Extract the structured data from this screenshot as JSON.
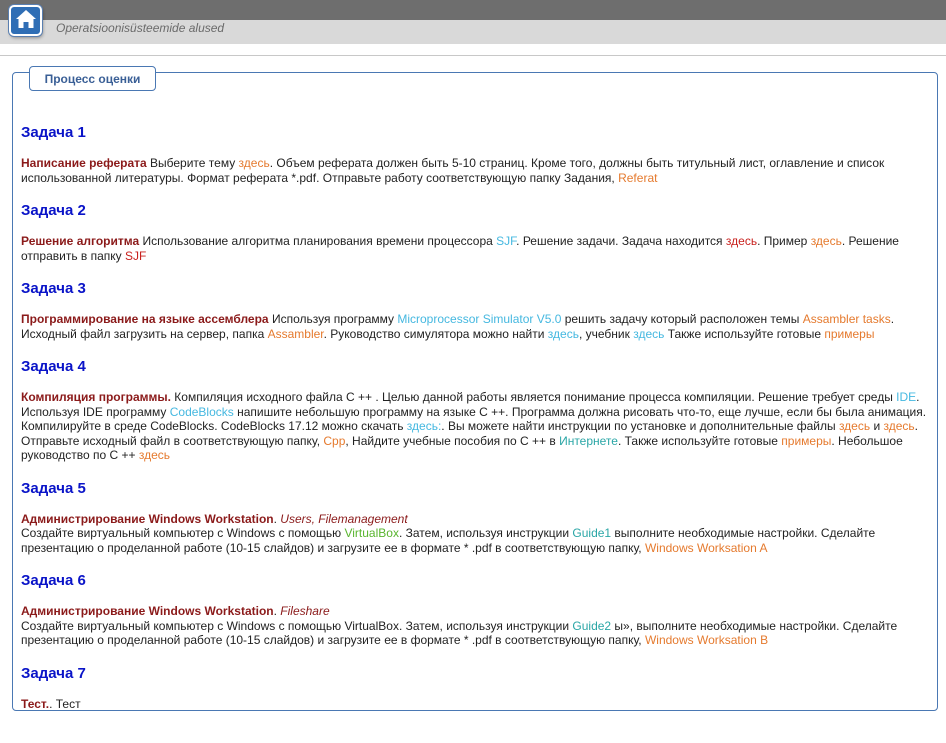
{
  "header": {
    "course_title": "Operatsioonisüsteemide alused",
    "home_icon": "home-icon"
  },
  "panel": {
    "title": "Процесс оценки"
  },
  "colors": {
    "task_heading": "#0a14c8",
    "task_title": "#8b1a1a",
    "link_orange": "#e57a2e",
    "link_blue": "#45b8e0",
    "link_red": "#c8201d",
    "link_green": "#59b52f",
    "link_teal": "#2aa6a6",
    "panel_border": "#4a78b3"
  },
  "tasks": [
    {
      "heading": "Задача 1",
      "title": "Написание реферата",
      "t1": " Выберите тему ",
      "l1": "здесь",
      "t2": ". Объем реферата должен быть 5-10 страниц. Кроме того, должны быть титульный лист, оглавление и список использованной литературы. Формат реферата *.pdf. Отправьте работу соответствующую папку Задания, ",
      "l2": "Referat"
    },
    {
      "heading": "Задача 2",
      "title": "Решение алгоритма",
      "t1": " Использование алгоритма планирования времени процессора ",
      "l1": "SJF",
      "t2": ". Решение задачи. Задача находится ",
      "l2": "здесь",
      "t3": ". Пример ",
      "l3": "здесь",
      "t4": ". Решение отправить в папку ",
      "l4": "SJF"
    },
    {
      "heading": "Задача 3",
      "title": "Программирование на языке ассемблера",
      "t1": " Используя программу ",
      "l1": "Microprocessor Simulator V5.0",
      "t2": " решить задачу который расположен темы ",
      "l2": "Assambler tasks",
      "t3": ". Исходный файл загрузить на сервер, папка ",
      "l3": "Assambler",
      "t4": ". Руководство симулятора можно найти ",
      "l4": "здесь",
      "t5": ", учебник ",
      "l5": "здесь",
      "t6": " Также используйте готовые ",
      "l6": "примеры"
    },
    {
      "heading": "Задача 4",
      "title": "Компиляция программы.",
      "t1": " Компиляция исходного файла C ++ . Целью данной работы является понимание процесса компиляции. Решение требует среды ",
      "l1": "IDE",
      "t2": ". Используя IDE программу ",
      "l2": "CodeBlocks",
      "t3": " напишите небольшую программу на языке C ++. Программа должна рисовать что-то, еще лучше, если бы была анимация. Компилируйте в среде CodeBlocks. CodeBlocks 17.12 можно скачать ",
      "l3": "здесь:",
      "t4": ". Вы можете найти инструкции по установке и дополнительные файлы ",
      "l4": "здесь",
      "t5": " и ",
      "l5": "здесь",
      "t6": ". Отправьте исходный файл в соответствующую папку, ",
      "l6": "Cpp",
      "t7": ", Найдите учебные пособия по C ++ в ",
      "l7": "Интернете",
      "t8": ". Также используйте готовые ",
      "l8": "примеры",
      "t9": ". Небольшое руководство по C ++ ",
      "l9": "здесь"
    },
    {
      "heading": "Задача 5",
      "title": "Администрирование Windows Workstation",
      "dot": ". ",
      "subtitle": "Users, Filemanagement",
      "t1": "Создайте виртуальный компьютер с Windows с помощью ",
      "l1": "VirtualBox",
      "t2": ". Затем, используя инструкции ",
      "l2": "Guide1",
      "t3": "  выполните необходимые настройки. Сделайте презентацию о проделанной работе (10-15 слайдов) и загрузите ее в формате * .pdf в соответствующую папку, ",
      "l3": "Windows Worksation A"
    },
    {
      "heading": "Задача 6",
      "title": "Администрирование Windows Workstation",
      "dot": ". ",
      "subtitle": "Fileshare",
      "t1": "Создайте виртуальный компьютер с Windows с помощью VirtualBox. Затем, используя инструкции ",
      "l1": "Guide2",
      "t2": " ы», выполните необходимые настройки. Сделайте презентацию о проделанной работе (10-15 слайдов) и загрузите ее в формате * .pdf в соответствующую папку, ",
      "l2": "Windows Worksation B"
    },
    {
      "heading": "Задача 7",
      "title": "Тест.",
      "t1": ". Тест"
    }
  ]
}
